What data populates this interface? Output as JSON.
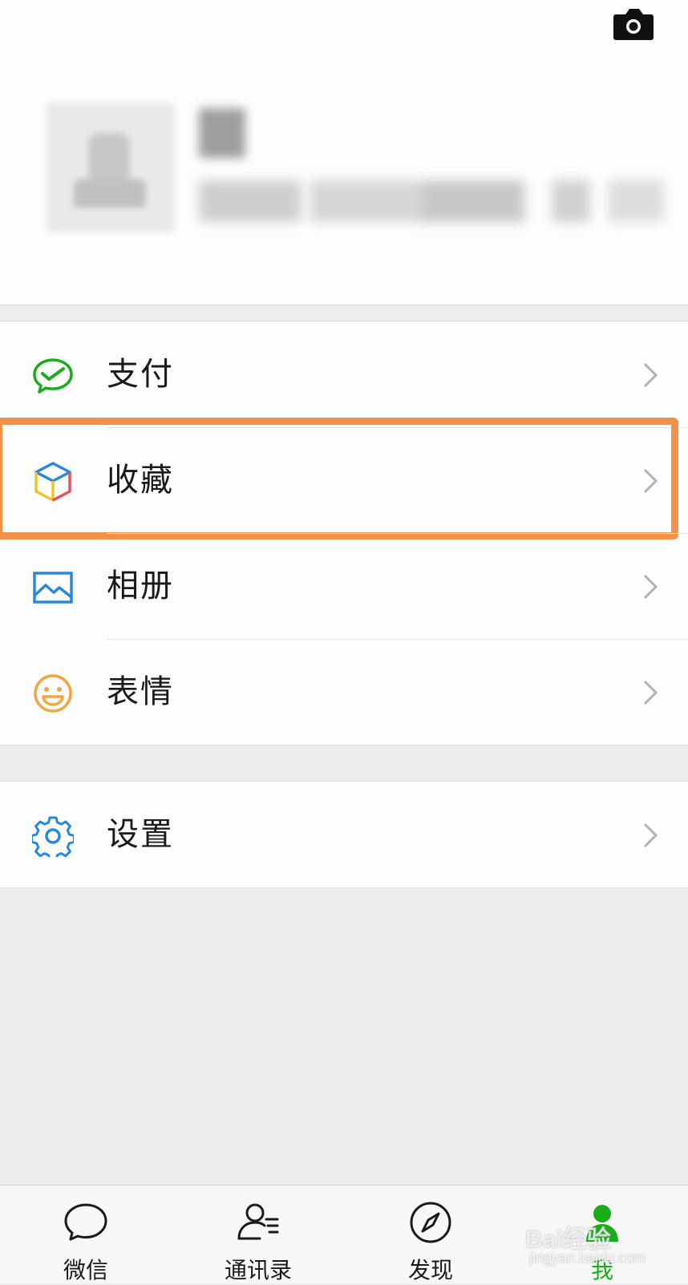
{
  "header": {
    "camera_icon": "camera-icon"
  },
  "menu_group_1": [
    {
      "id": "pay",
      "label": "支付",
      "icon": "wechat-pay-icon",
      "color": "#1aad19"
    },
    {
      "id": "favorites",
      "label": "收藏",
      "icon": "favorites-cube-icon",
      "highlighted": true
    },
    {
      "id": "album",
      "label": "相册",
      "icon": "album-image-icon",
      "color": "#2b88d8"
    },
    {
      "id": "stickers",
      "label": "表情",
      "icon": "smiley-icon",
      "color": "#f1a640"
    }
  ],
  "menu_group_2": [
    {
      "id": "settings",
      "label": "设置",
      "icon": "gear-icon",
      "color": "#2b88d8"
    }
  ],
  "tabbar": [
    {
      "id": "chats",
      "label": "微信",
      "icon": "chat-bubble-icon"
    },
    {
      "id": "contacts",
      "label": "通讯录",
      "icon": "contacts-icon"
    },
    {
      "id": "discover",
      "label": "发现",
      "icon": "compass-icon"
    },
    {
      "id": "me",
      "label": "我",
      "icon": "person-icon",
      "active": true
    }
  ],
  "colors": {
    "accent": "#1aad19",
    "highlight_box": "#f0924a"
  },
  "watermark": {
    "text": "Bai经验",
    "sub": "jingyan.baidu.com"
  }
}
